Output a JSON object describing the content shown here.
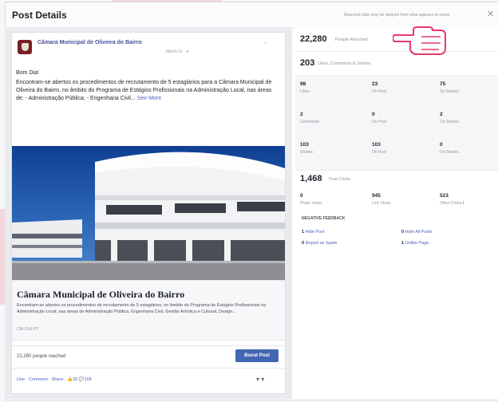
{
  "dialog": {
    "title": "Post Details",
    "note": "Reported stats may be delayed from what appears on posts",
    "close_icon": "✕"
  },
  "post": {
    "page_name": "Câmara Municipal de Oliveira do Bairro",
    "time": "March 11 · ✈",
    "menu_icon": "⌄",
    "greeting": "Bom Dia!",
    "text": "Encontram-se abertos os procedimentos de recrutamento de 5 estagiários para a Câmara Municipal de Oliveira do Bairro, no âmbito do Programa de Estágios Profissionais na Administração Local, nas áreas de: - Administração Pública; - Engenharia Civil...",
    "see_more": "See More",
    "link_title": "Câmara Municipal de Oliveira do Bairro",
    "link_desc": "Encontram-se abertos os procedimentos de recrutamento de 5 estagiários, no âmbito do Programa de Estágios Profissionais na Administração Local, nas áreas de Administração Pública, Engenharia Civil, Gestão Artística e Cultural, Design...",
    "link_domain": "CM-OLB.PT",
    "reach": "22,280 people reached",
    "boost_label": "Boost Post",
    "actions": "Like · Comment · Share · 👍25 💬105",
    "actions_menu": "▾ ▾"
  },
  "stats": {
    "reached": {
      "value": "22,280",
      "label": "People Reached"
    },
    "engagement": {
      "value": "203",
      "label": "Likes, Comments & Shares"
    },
    "likes": {
      "total": "98",
      "total_label": "Likes",
      "on_post": "23",
      "on_post_label": "On Post",
      "on_shares": "75",
      "on_shares_label": "On Shares"
    },
    "comments": {
      "total": "2",
      "total_label": "Comments",
      "on_post": "0",
      "on_post_label": "On Post",
      "on_shares": "2",
      "on_shares_label": "On Shares"
    },
    "shares": {
      "total": "103",
      "total_label": "Shares",
      "on_post": "103",
      "on_post_label": "On Post",
      "on_shares": "0",
      "on_shares_label": "On Shares"
    },
    "clicks": {
      "value": "1,468",
      "label": "Post Clicks"
    },
    "click_breakdown": {
      "photo": "0",
      "photo_label": "Photo Views",
      "link": "945",
      "link_label": "Link Clicks",
      "other": "523",
      "other_label": "Other Clicks ℹ"
    },
    "negative": {
      "header": "NEGATIVE FEEDBACK",
      "hide_post": {
        "value": "1",
        "label": "Hide Post"
      },
      "hide_all": {
        "value": "0",
        "label": "Hide All Posts"
      },
      "spam": {
        "value": "0",
        "label": "Report as Spam"
      },
      "unlike": {
        "value": "1",
        "label": "Unlike Page"
      }
    }
  },
  "colors": {
    "facebook_blue": "#4267b2",
    "link_blue": "#4b5ec4",
    "accent_pink": "#f3d7dd"
  },
  "icons": {
    "close": "close-icon",
    "pointer": "pointing-hand-icon",
    "menu": "chevron-down-icon"
  }
}
